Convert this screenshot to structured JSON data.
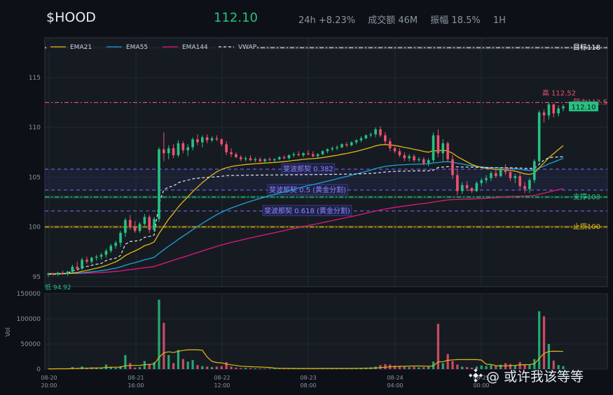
{
  "header": {
    "ticker": "$HOOD",
    "price": "112.10",
    "change": "24h +8.23%",
    "volume": "成交额 46M",
    "amplitude": "振幅 18.5%",
    "interval": "1H"
  },
  "watermark": "@ 或许我该等等",
  "chart_data": [
    {
      "type": "candlestick",
      "legend": [
        "EMA21",
        "EMA55",
        "EMA144",
        "VWAP"
      ],
      "legend_position": "top-left",
      "ylim": [
        94,
        119
      ],
      "y_ticks": [
        95,
        100,
        105,
        110,
        115
      ],
      "x_ticks": [
        "08-20\n20:00",
        "08-21\n16:00",
        "08-22\n12:00",
        "08-23\n08:00",
        "08-24\n04:00",
        "08-25\n00:00"
      ],
      "grid": true,
      "levels": [
        {
          "name": "target",
          "value": 118,
          "label": "目标118",
          "color": "#c8ccd4",
          "style": "dashdot"
        },
        {
          "name": "high",
          "value": 112.52,
          "label": "高 112.52",
          "color": "#f0506e",
          "style": "none"
        },
        {
          "name": "resistance",
          "value": 112.5,
          "label": "阻力112.5",
          "color": "#f0506e",
          "style": "dashdot"
        },
        {
          "name": "fib-382",
          "value": 105.8,
          "label": "斐波那契 0.382",
          "color": "#6b5bd6",
          "style": "dashed"
        },
        {
          "name": "fib-500",
          "value": 103.7,
          "label": "斐波那契 0.5 (黄金分割)",
          "color": "#6b5bd6",
          "style": "dashed"
        },
        {
          "name": "support",
          "value": 103,
          "label": "支撑103",
          "color": "#26c281",
          "style": "dashdot"
        },
        {
          "name": "fib-618",
          "value": 101.6,
          "label": "斐波那契 0.618 (黄金分割)",
          "color": "#6b5bd6",
          "style": "dashed"
        },
        {
          "name": "stop-loss",
          "value": 100,
          "label": "止损100",
          "color": "#e2b713",
          "style": "dashdot"
        },
        {
          "name": "low",
          "value": 94.92,
          "label": "低 94.92",
          "color": "#26c281",
          "style": "none"
        }
      ],
      "last_price_label": "112.10",
      "colors": {
        "up": "#26c281",
        "down": "#f0506e",
        "ema21": "#e2b713",
        "ema55": "#1aa3d9",
        "ema144": "#e0197d",
        "vwap": "#e6e6e6"
      },
      "ohlc": [
        [
          95.2,
          95.4,
          95.0,
          95.3
        ],
        [
          95.3,
          95.4,
          95.1,
          95.2
        ],
        [
          95.2,
          95.5,
          95.1,
          95.4
        ],
        [
          95.4,
          95.6,
          95.2,
          95.3
        ],
        [
          95.3,
          95.6,
          95.1,
          95.5
        ],
        [
          95.5,
          96.2,
          95.4,
          96.0
        ],
        [
          96.0,
          96.5,
          95.7,
          95.8
        ],
        [
          95.8,
          96.9,
          95.7,
          96.7
        ],
        [
          96.7,
          97.0,
          96.3,
          96.5
        ],
        [
          96.5,
          97.0,
          96.3,
          96.9
        ],
        [
          96.9,
          97.2,
          96.6,
          97.0
        ],
        [
          97.0,
          97.4,
          96.7,
          97.2
        ],
        [
          97.2,
          97.8,
          96.9,
          97.6
        ],
        [
          97.6,
          98.3,
          97.4,
          98.1
        ],
        [
          98.1,
          98.6,
          97.8,
          98.4
        ],
        [
          98.4,
          99.6,
          98.0,
          99.4
        ],
        [
          99.4,
          100.9,
          99.0,
          100.7
        ],
        [
          100.7,
          101.2,
          99.7,
          100.0
        ],
        [
          100.0,
          100.6,
          99.4,
          99.6
        ],
        [
          99.6,
          100.5,
          99.4,
          100.3
        ],
        [
          100.3,
          101.3,
          100.1,
          101.0
        ],
        [
          101.0,
          101.2,
          99.4,
          99.7
        ],
        [
          99.7,
          101.0,
          99.5,
          100.8
        ],
        [
          100.8,
          108.0,
          100.5,
          107.8
        ],
        [
          107.8,
          109.5,
          106.6,
          107.4
        ],
        [
          107.4,
          108.2,
          106.8,
          107.9
        ],
        [
          107.9,
          108.3,
          106.9,
          107.2
        ],
        [
          107.2,
          108.7,
          107.0,
          108.4
        ],
        [
          108.4,
          108.6,
          107.4,
          107.7
        ],
        [
          107.7,
          108.3,
          107.1,
          108.0
        ],
        [
          108.0,
          109.0,
          107.7,
          108.8
        ],
        [
          108.8,
          109.3,
          108.2,
          108.5
        ],
        [
          108.5,
          109.2,
          108.0,
          109.0
        ],
        [
          109.0,
          109.3,
          108.4,
          108.7
        ],
        [
          108.7,
          109.1,
          108.5,
          108.9
        ],
        [
          108.9,
          109.2,
          108.6,
          108.8
        ],
        [
          108.8,
          108.9,
          108.1,
          108.3
        ],
        [
          108.3,
          108.6,
          107.2,
          107.5
        ],
        [
          107.5,
          107.9,
          107.0,
          107.3
        ],
        [
          107.3,
          107.5,
          106.9,
          107.0
        ],
        [
          107.0,
          107.2,
          106.6,
          106.8
        ],
        [
          106.8,
          107.1,
          106.6,
          106.9
        ],
        [
          106.9,
          107.2,
          106.6,
          106.7
        ],
        [
          106.7,
          107.0,
          106.5,
          106.8
        ],
        [
          106.8,
          107.0,
          106.5,
          106.6
        ],
        [
          106.6,
          106.9,
          106.5,
          106.8
        ],
        [
          106.8,
          107.0,
          106.6,
          106.7
        ],
        [
          106.7,
          106.9,
          106.5,
          106.8
        ],
        [
          106.8,
          107.1,
          106.7,
          107.0
        ],
        [
          107.0,
          107.2,
          106.8,
          106.9
        ],
        [
          106.9,
          107.3,
          106.8,
          107.2
        ],
        [
          107.2,
          107.5,
          107.0,
          107.3
        ],
        [
          107.3,
          107.6,
          107.1,
          107.2
        ],
        [
          107.2,
          107.5,
          107.0,
          107.4
        ],
        [
          107.4,
          107.7,
          107.2,
          107.3
        ],
        [
          107.3,
          107.6,
          107.0,
          107.1
        ],
        [
          107.1,
          107.4,
          106.9,
          107.3
        ],
        [
          107.3,
          107.7,
          107.2,
          107.6
        ],
        [
          107.6,
          107.9,
          107.4,
          107.8
        ],
        [
          107.8,
          108.1,
          107.6,
          107.9
        ],
        [
          107.9,
          108.2,
          107.7,
          108.0
        ],
        [
          108.0,
          108.4,
          107.9,
          108.3
        ],
        [
          108.3,
          108.5,
          108.0,
          108.2
        ],
        [
          108.2,
          108.6,
          108.1,
          108.5
        ],
        [
          108.5,
          108.8,
          108.3,
          108.7
        ],
        [
          108.7,
          109.1,
          108.5,
          108.9
        ],
        [
          108.9,
          109.3,
          108.8,
          109.2
        ],
        [
          109.2,
          109.5,
          109.0,
          109.3
        ],
        [
          109.3,
          110.0,
          109.0,
          109.8
        ],
        [
          109.8,
          110.1,
          109.0,
          109.2
        ],
        [
          109.2,
          109.5,
          108.3,
          108.6
        ],
        [
          108.6,
          108.9,
          107.6,
          107.9
        ],
        [
          107.9,
          108.2,
          107.4,
          107.6
        ],
        [
          107.6,
          107.9,
          107.0,
          107.2
        ],
        [
          107.2,
          107.5,
          106.6,
          106.9
        ],
        [
          106.9,
          107.3,
          106.6,
          107.1
        ],
        [
          107.1,
          107.3,
          106.5,
          106.7
        ],
        [
          106.7,
          107.0,
          106.5,
          106.8
        ],
        [
          106.8,
          107.0,
          106.2,
          106.4
        ],
        [
          106.4,
          106.9,
          106.1,
          106.7
        ],
        [
          106.7,
          109.5,
          106.5,
          109.2
        ],
        [
          109.2,
          109.8,
          107.0,
          107.4
        ],
        [
          107.4,
          108.8,
          106.6,
          108.4
        ],
        [
          108.4,
          108.6,
          106.5,
          106.8
        ],
        [
          106.8,
          107.2,
          104.8,
          105.2
        ],
        [
          105.2,
          105.8,
          103.2,
          103.6
        ],
        [
          103.6,
          104.5,
          103.3,
          104.2
        ],
        [
          104.2,
          104.6,
          103.6,
          103.9
        ],
        [
          103.9,
          104.0,
          103.4,
          103.6
        ],
        [
          103.6,
          104.6,
          103.5,
          104.4
        ],
        [
          104.4,
          104.9,
          104.1,
          104.7
        ],
        [
          104.7,
          105.2,
          104.4,
          104.9
        ],
        [
          104.9,
          105.6,
          104.6,
          105.4
        ],
        [
          105.4,
          105.8,
          104.9,
          105.1
        ],
        [
          105.1,
          106.0,
          105.0,
          105.8
        ],
        [
          105.8,
          106.3,
          105.2,
          105.5
        ],
        [
          105.5,
          105.9,
          104.6,
          104.9
        ],
        [
          104.9,
          105.3,
          104.4,
          105.1
        ],
        [
          105.1,
          105.4,
          103.8,
          104.1
        ],
        [
          104.1,
          104.5,
          103.4,
          103.8
        ],
        [
          103.8,
          104.9,
          103.4,
          104.7
        ],
        [
          104.7,
          106.8,
          104.4,
          106.6
        ],
        [
          106.6,
          111.7,
          106.4,
          111.5
        ],
        [
          111.5,
          111.8,
          110.5,
          111.2
        ],
        [
          111.2,
          112.52,
          110.8,
          112.3
        ],
        [
          112.3,
          112.4,
          111.0,
          111.4
        ],
        [
          111.4,
          112.2,
          111.1,
          111.9
        ],
        [
          111.9,
          112.3,
          111.6,
          112.1
        ]
      ],
      "volume": {
        "ylim": [
          0,
          150000
        ],
        "y_ticks": [
          0,
          50000,
          100000,
          150000
        ],
        "ylabel": "Vol",
        "values": [
          500,
          600,
          800,
          700,
          1200,
          4000,
          1800,
          5200,
          2100,
          3500,
          3000,
          2800,
          9000,
          4500,
          2500,
          6000,
          28000,
          12000,
          3000,
          4000,
          16000,
          10000,
          14000,
          138000,
          92000,
          28000,
          12000,
          38000,
          20000,
          15000,
          18000,
          8000,
          6000,
          5000,
          4000,
          5000,
          6000,
          14000,
          5000,
          3000,
          2000,
          2500,
          1800,
          1500,
          1200,
          1000,
          1200,
          1000,
          1200,
          1000,
          1500,
          1800,
          1500,
          1200,
          1000,
          1200,
          1400,
          1600,
          1500,
          1300,
          1500,
          1800,
          1600,
          1400,
          2000,
          2500,
          3000,
          3500,
          5000,
          8000,
          10000,
          9000,
          7000,
          6000,
          5000,
          4000,
          4500,
          3500,
          4000,
          5000,
          15000,
          90000,
          12000,
          30000,
          16000,
          9000,
          5000,
          4000,
          3000,
          5000,
          7000,
          6000,
          8000,
          6000,
          9000,
          12000,
          10000,
          8000,
          14000,
          9000,
          8000,
          20000,
          115000,
          105000,
          50000,
          17000,
          8000,
          6000
        ]
      }
    }
  ]
}
